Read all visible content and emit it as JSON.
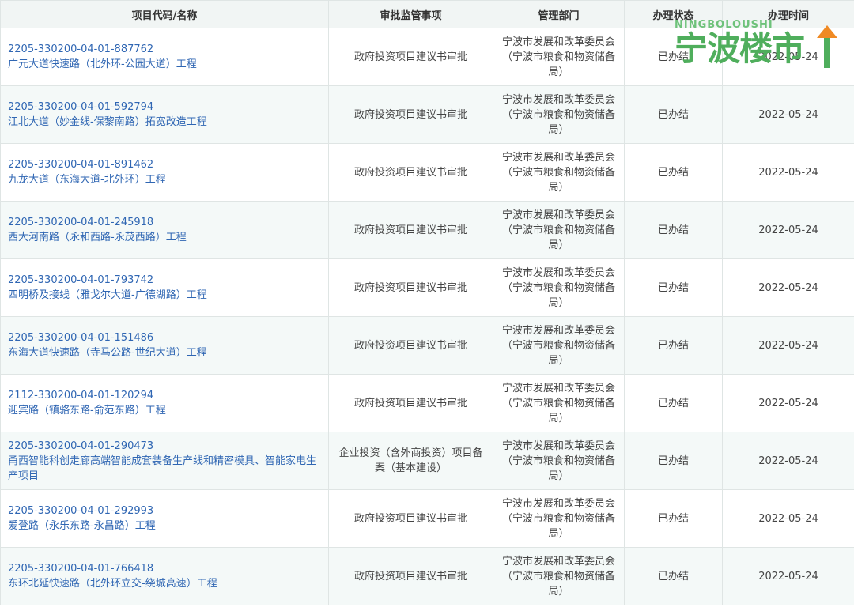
{
  "table": {
    "headers": [
      "项目代码/名称",
      "审批监管事项",
      "管理部门",
      "办理状态",
      "办理时间"
    ],
    "rows": [
      {
        "code": "2205-330200-04-01-887762",
        "name": "广元大道快速路（北外环-公园大道）工程",
        "item": "政府投资项目建议书审批",
        "dept": "宁波市发展和改革委员会（宁波市粮食和物资储备局）",
        "status": "已办结",
        "date": "2022-05-24"
      },
      {
        "code": "2205-330200-04-01-592794",
        "name": "江北大道（妙金线-保黎南路）拓宽改造工程",
        "item": "政府投资项目建议书审批",
        "dept": "宁波市发展和改革委员会（宁波市粮食和物资储备局）",
        "status": "已办结",
        "date": "2022-05-24"
      },
      {
        "code": "2205-330200-04-01-891462",
        "name": "九龙大道（东海大道-北外环）工程",
        "item": "政府投资项目建议书审批",
        "dept": "宁波市发展和改革委员会（宁波市粮食和物资储备局）",
        "status": "已办结",
        "date": "2022-05-24"
      },
      {
        "code": "2205-330200-04-01-245918",
        "name": "西大河南路（永和西路-永茂西路）工程",
        "item": "政府投资项目建议书审批",
        "dept": "宁波市发展和改革委员会（宁波市粮食和物资储备局）",
        "status": "已办结",
        "date": "2022-05-24"
      },
      {
        "code": "2205-330200-04-01-793742",
        "name": "四明桥及接线（雅戈尔大道-广德湖路）工程",
        "item": "政府投资项目建议书审批",
        "dept": "宁波市发展和改革委员会（宁波市粮食和物资储备局）",
        "status": "已办结",
        "date": "2022-05-24"
      },
      {
        "code": "2205-330200-04-01-151486",
        "name": "东海大道快速路（寺马公路-世纪大道）工程",
        "item": "政府投资项目建议书审批",
        "dept": "宁波市发展和改革委员会（宁波市粮食和物资储备局）",
        "status": "已办结",
        "date": "2022-05-24"
      },
      {
        "code": "2112-330200-04-01-120294",
        "name": "迎宾路（镇骆东路-俞范东路）工程",
        "item": "政府投资项目建议书审批",
        "dept": "宁波市发展和改革委员会（宁波市粮食和物资储备局）",
        "status": "已办结",
        "date": "2022-05-24"
      },
      {
        "code": "2205-330200-04-01-290473",
        "name": "甬西智能科创走廊高端智能成套装备生产线和精密模具、智能家电生产项目",
        "item": "企业投资（含外商投资）项目备案（基本建设）",
        "dept": "宁波市发展和改革委员会（宁波市粮食和物资储备局）",
        "status": "已办结",
        "date": "2022-05-24"
      },
      {
        "code": "2205-330200-04-01-292993",
        "name": "爱登路（永乐东路-永昌路）工程",
        "item": "政府投资项目建议书审批",
        "dept": "宁波市发展和改革委员会（宁波市粮食和物资储备局）",
        "status": "已办结",
        "date": "2022-05-24"
      },
      {
        "code": "2205-330200-04-01-766418",
        "name": "东环北延快速路（北外环立交-绕城高速）工程",
        "item": "政府投资项目建议书审批",
        "dept": "宁波市发展和改革委员会（宁波市粮食和物资储备局）",
        "status": "已办结",
        "date": "2022-05-24"
      }
    ]
  },
  "watermark": {
    "subtitle": "NINGBOLOUSHI",
    "title": "宁波楼市"
  }
}
